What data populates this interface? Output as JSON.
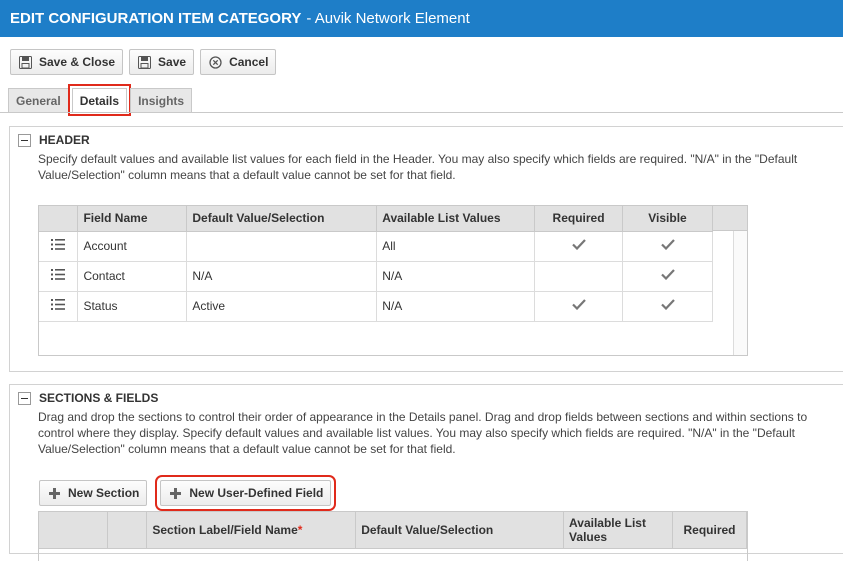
{
  "title": {
    "prefix": "EDIT CONFIGURATION ITEM CATEGORY",
    "suffix": "- Auvik Network Element"
  },
  "toolbar": {
    "save_close": "Save & Close",
    "save": "Save",
    "cancel": "Cancel"
  },
  "tabs": [
    {
      "label": "General",
      "active": false
    },
    {
      "label": "Details",
      "active": true
    },
    {
      "label": "Insights",
      "active": false
    }
  ],
  "header_section": {
    "title": "HEADER",
    "description": "Specify default values and available list values for each field in the Header. You may also specify which fields are required. \"N/A\" in the \"Default Value/Selection\" column means that a default value cannot be set for that field.",
    "columns": [
      "Field Name",
      "Default Value/Selection",
      "Available List Values",
      "Required",
      "Visible"
    ],
    "rows": [
      {
        "field": "Account",
        "default": "",
        "list": "All",
        "required": true,
        "visible": true
      },
      {
        "field": "Contact",
        "default": "N/A",
        "list": "N/A",
        "required": false,
        "visible": true
      },
      {
        "field": "Status",
        "default": "Active",
        "list": "N/A",
        "required": true,
        "visible": true
      }
    ]
  },
  "sections_section": {
    "title": "SECTIONS & FIELDS",
    "description": "Drag and drop the sections to control their order of appearance in the Details panel. Drag and drop fields between sections and within sections to control where they display. Specify default values and available list values. You may also specify which fields are required. \"N/A\" in the \"Default Value/Selection\" column means that a default value cannot be set for that field.",
    "new_section": "New Section",
    "new_udf": "New User-Defined Field",
    "columns": [
      "Section Label/Field Name",
      "Default Value/Selection",
      "Available List Values",
      "Required"
    ],
    "required_mark": "*"
  },
  "colors": {
    "accent": "#1e7ec8",
    "highlight": "#e02a1b",
    "check": "#777777"
  },
  "icons": {
    "save": "floppy-icon",
    "cancel": "circle-x-icon",
    "add": "plus-icon",
    "drag": "drag-handle-icon",
    "check": "checkmark-icon"
  }
}
